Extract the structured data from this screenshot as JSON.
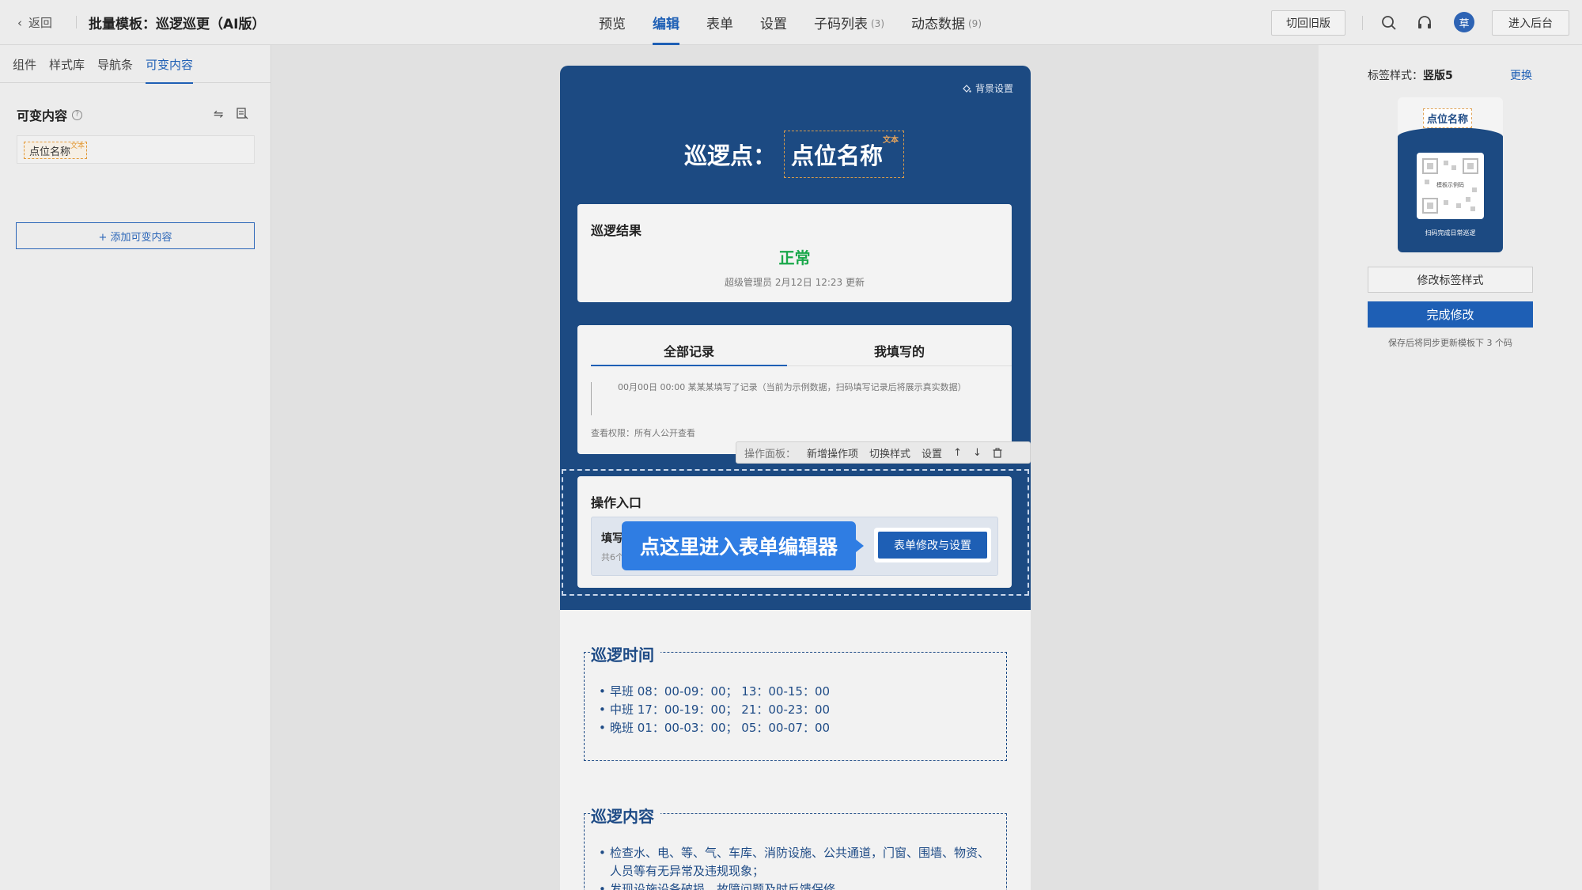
{
  "header": {
    "back_label": "返回",
    "title": "批量模板：巡逻巡更（AI版）",
    "tabs": [
      {
        "label": "预览",
        "count": ""
      },
      {
        "label": "编辑",
        "count": ""
      },
      {
        "label": "表单",
        "count": ""
      },
      {
        "label": "设置",
        "count": ""
      },
      {
        "label": "子码列表",
        "count": "(3)"
      },
      {
        "label": "动态数据",
        "count": "(9)"
      }
    ],
    "switch_old_label": "切回旧版",
    "avatar_text": "草",
    "admin_label": "进入后台",
    "accent_color": "#1e5fb5"
  },
  "left_panel": {
    "tabs": [
      "组件",
      "样式库",
      "导航条",
      "可变内容"
    ],
    "heading": "可变内容",
    "variable": {
      "label": "点位名称",
      "tag": "文本"
    },
    "add_label": "+ 添加可变内容"
  },
  "phone": {
    "bg_setting": "背景设置",
    "title_prefix": "巡逻点：",
    "title_var": "点位名称",
    "title_var_tag": "文本",
    "result_card": {
      "heading": "巡逻结果",
      "status": "正常",
      "status_color": "#1aa84b",
      "meta": "超级管理员 2月12日 12:23 更新"
    },
    "record_card": {
      "tabs": [
        "全部记录",
        "我填写的"
      ],
      "record": "00月00日 00:00   某某某填写了记录（当前为示例数据，扫码填写记录后将展示真实数据）",
      "permission": "查看权限：所有人公开查看"
    },
    "op_panel": {
      "label": "操作面板：",
      "items": [
        "新增操作项",
        "切换样式",
        "设置"
      ]
    },
    "entry_card": {
      "heading": "操作入口",
      "item_title": "填写",
      "item_sub": "共6个",
      "bubble": "点这里进入表单编辑器",
      "form_button": "表单修改与设置"
    },
    "time_section": {
      "title": "巡逻时间",
      "items": [
        "早班   08：00-09：00；   13：00-15：00",
        "中班   17：00-19：00；   21：00-23：00",
        "晚班   01：00-03：00；   05：00-07：00"
      ]
    },
    "content_section": {
      "title": "巡逻内容",
      "items": [
        "检查水、电、等、气、车库、消防设施、公共通道，门窗、围墙、物资、人员等有无异常及违规现象；",
        "发现设施设备破损、故障问题及时反馈保修"
      ]
    }
  },
  "right_panel": {
    "label_prefix": "标签样式：",
    "label_value": "竖版5",
    "change_label": "更换",
    "preview": {
      "name": "点位名称",
      "qr_caption": "模板示例码",
      "footer": "扫码完成日常巡逻"
    },
    "modify_label": "修改标签样式",
    "done_label": "完成修改",
    "note": "保存后将同步更新模板下 3 个码"
  }
}
